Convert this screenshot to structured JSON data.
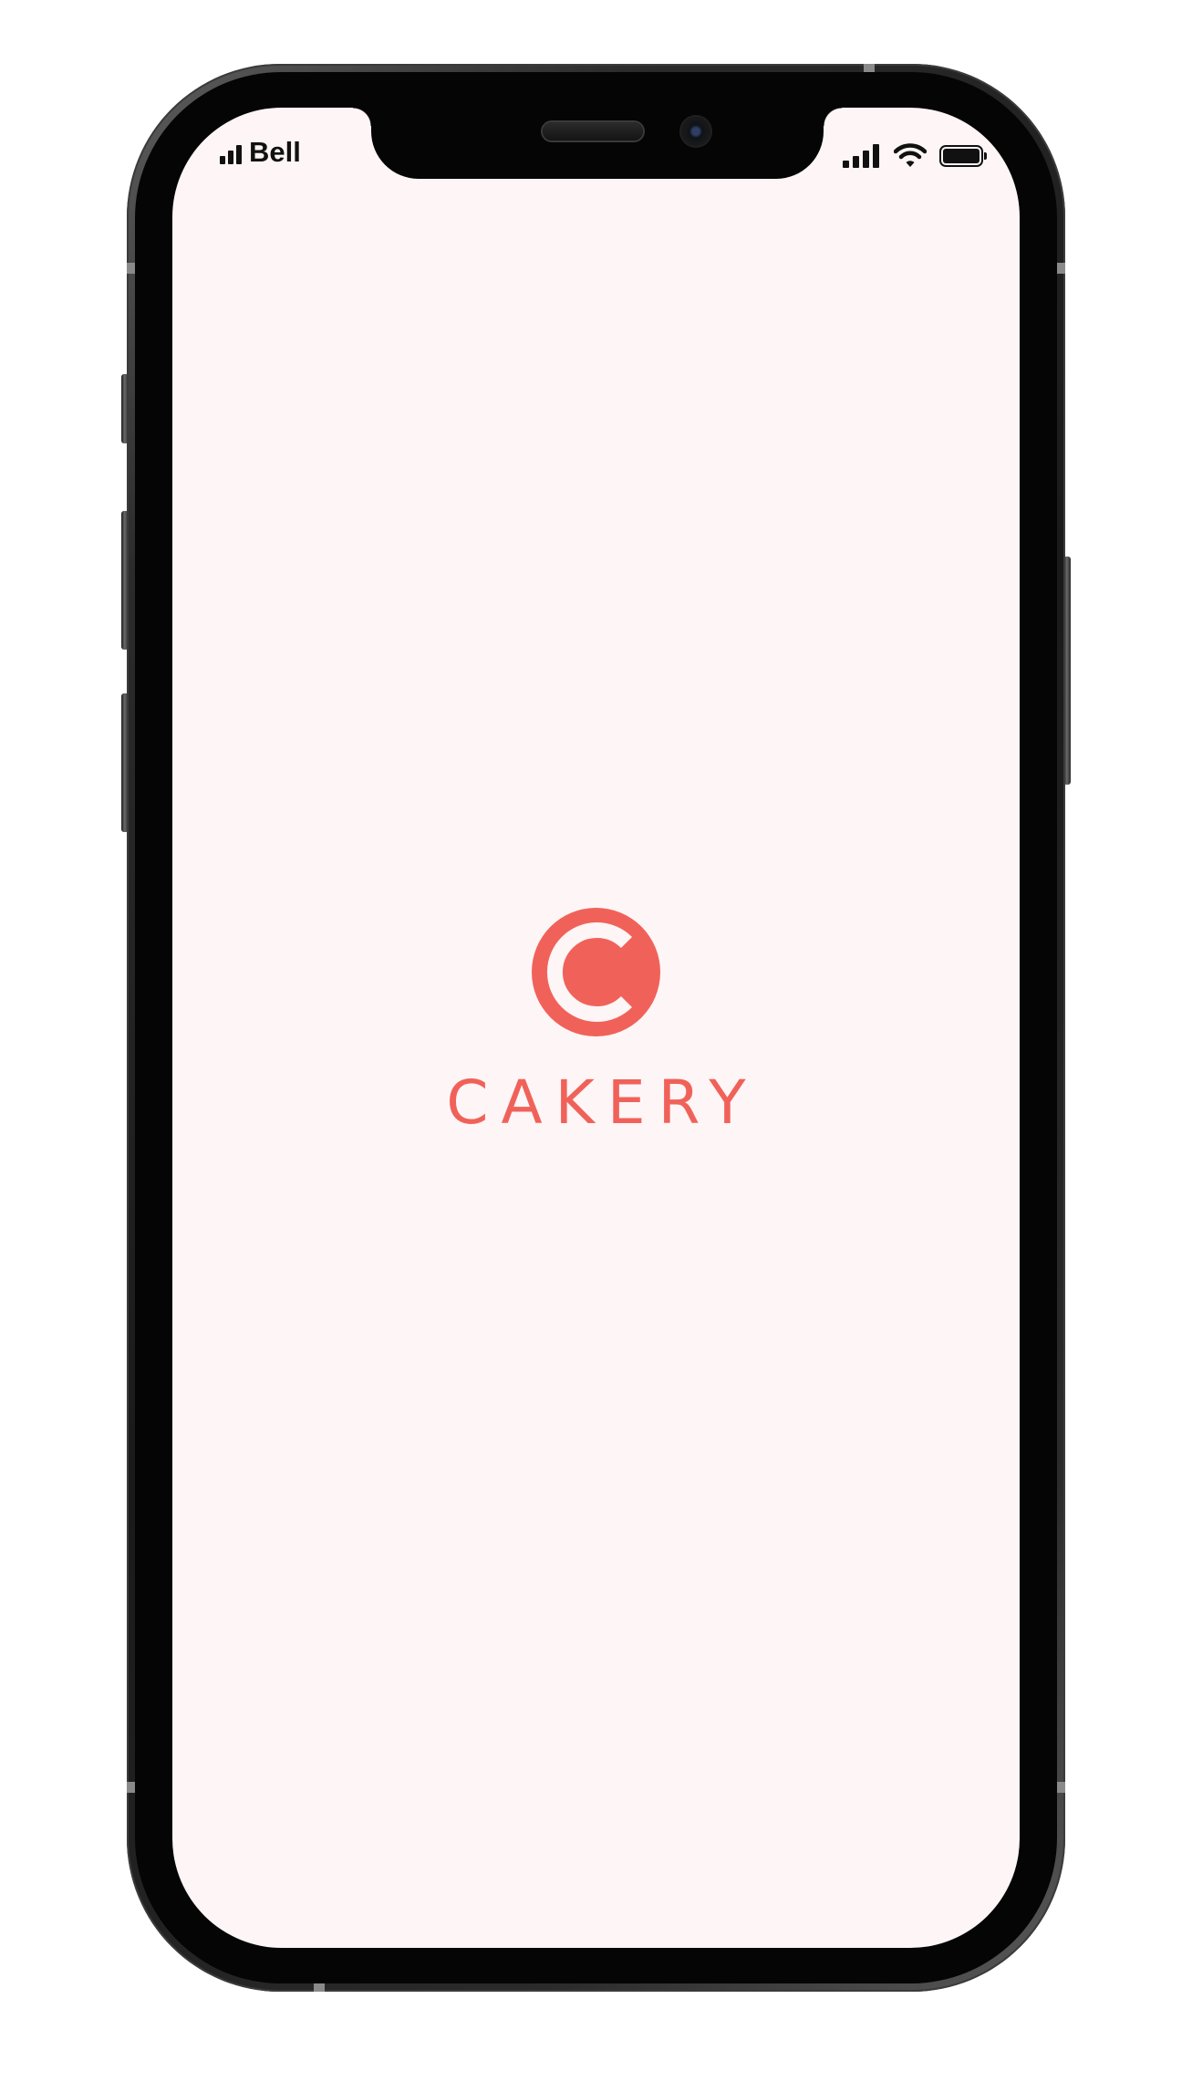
{
  "status_bar": {
    "carrier": "Bell",
    "battery_level": 1.0
  },
  "brand": {
    "name": "CAKERY",
    "logo_letter": "C",
    "logo_icon": "cakery-c-logo-icon",
    "accent_color": "#f06259",
    "background_color": "#fdf5f6"
  },
  "icons": {
    "carrier_signal": "signal-bars-icon",
    "cellular": "cellular-signal-icon",
    "wifi": "wifi-icon",
    "battery": "battery-icon"
  }
}
